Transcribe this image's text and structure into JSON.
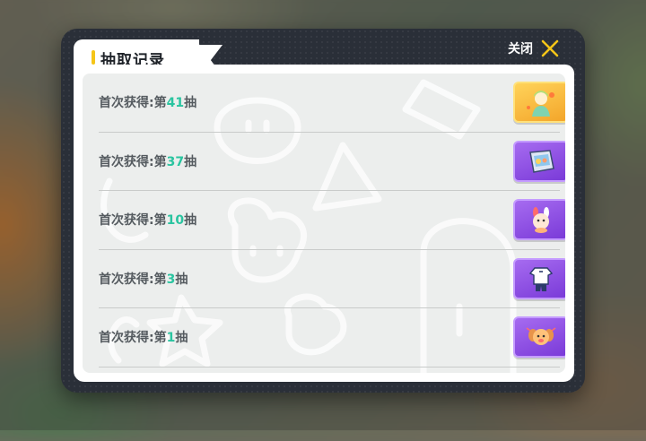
{
  "header": {
    "title": "抽取记录"
  },
  "close": {
    "label": "关闭",
    "icon": "close-icon"
  },
  "records": [
    {
      "prefix": "首次获得:第",
      "number": "41",
      "suffix": "抽",
      "rarity": "gold",
      "icon": "character-card-icon"
    },
    {
      "prefix": "首次获得:第",
      "number": "37",
      "suffix": "抽",
      "rarity": "purple",
      "icon": "device-item-icon"
    },
    {
      "prefix": "首次获得:第",
      "number": "10",
      "suffix": "抽",
      "rarity": "purple",
      "icon": "bunny-accessory-icon"
    },
    {
      "prefix": "首次获得:第",
      "number": "3",
      "suffix": "抽",
      "rarity": "purple",
      "icon": "outfit-item-icon"
    },
    {
      "prefix": "首次获得:第",
      "number": "1",
      "suffix": "抽",
      "rarity": "purple",
      "icon": "puppy-accessory-icon"
    }
  ],
  "colors": {
    "accent": "#f5c518",
    "number": "#2ac4a0",
    "gold_rarity": "#f3a52a",
    "purple_rarity": "#8a4ae0",
    "panel": "#2a2f38"
  }
}
